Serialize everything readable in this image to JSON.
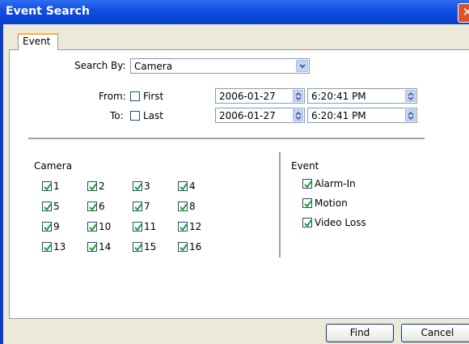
{
  "window": {
    "title": "Event Search",
    "close_glyph": "✕"
  },
  "tabs": [
    {
      "label": "Event"
    }
  ],
  "search_by": {
    "label": "Search By:",
    "value": "Camera"
  },
  "from": {
    "label": "From:",
    "check_label": "First",
    "checked": false,
    "date": "2006-01-27",
    "time": "6:20:41 PM"
  },
  "to": {
    "label": "To:",
    "check_label": "Last",
    "checked": false,
    "date": "2006-01-27",
    "time": "6:20:41 PM"
  },
  "camera_group": {
    "title": "Camera",
    "items": [
      "1",
      "2",
      "3",
      "4",
      "5",
      "6",
      "7",
      "8",
      "9",
      "10",
      "11",
      "12",
      "13",
      "14",
      "15",
      "16"
    ],
    "all_checked": true
  },
  "event_group": {
    "title": "Event",
    "items": [
      "Alarm-In",
      "Motion",
      "Video Loss"
    ],
    "all_checked": true
  },
  "buttons": {
    "find": "Find",
    "cancel": "Cancel"
  },
  "colors": {
    "titlebar": "#0b3fc4",
    "face": "#ece9d8",
    "tab_accent": "#f5b13f",
    "check": "#21a121"
  }
}
